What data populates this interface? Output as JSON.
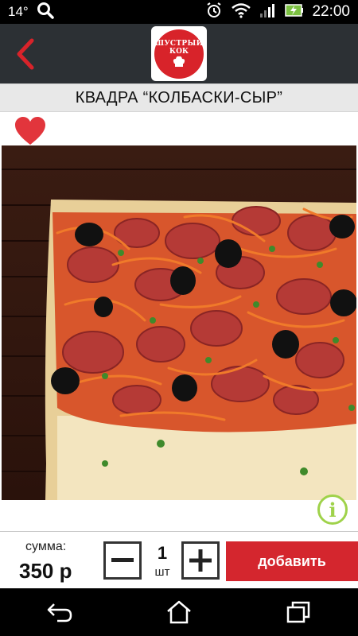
{
  "status_bar": {
    "temperature": "14°",
    "time": "22:00",
    "icons": [
      "search-icon",
      "alarm-icon",
      "wifi-icon",
      "signal-icon",
      "battery-charging-icon"
    ]
  },
  "app_bar": {
    "logo_line1": "ШУСТРЫЙ",
    "logo_line2": "КОК",
    "accent_color": "#d8232a",
    "back_icon": "chevron-left-icon"
  },
  "product": {
    "title": "КВАДРА “КОЛБАСКИ-СЫР”",
    "favorite_icon": "heart-icon",
    "info_icon": "info-icon"
  },
  "footer": {
    "sum_label": "сумма:",
    "sum_value": "350 р",
    "quantity": "1",
    "unit": "шт",
    "minus_label": "−",
    "plus_label": "+",
    "add_label": "добавить",
    "add_color": "#d4262e"
  },
  "nav_bar": {
    "icons": [
      "back-icon",
      "home-icon",
      "recent-apps-icon"
    ]
  }
}
